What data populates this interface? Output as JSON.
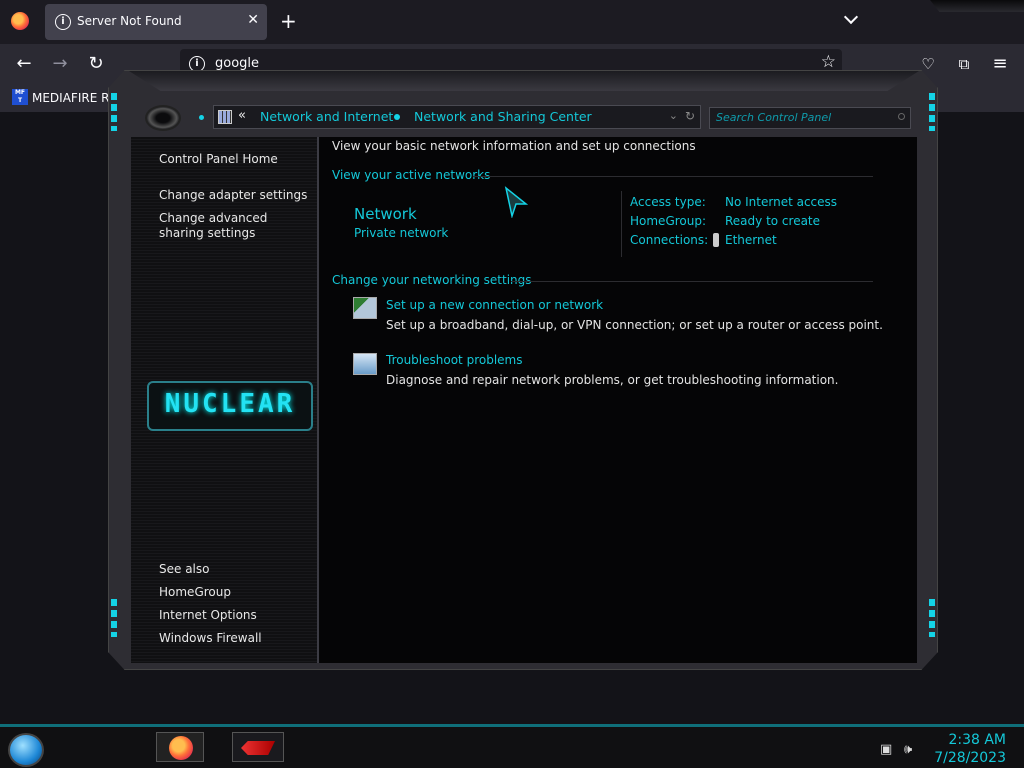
{
  "browser": {
    "tab_title": "Server Not Found",
    "new_tab_symbol": "+",
    "close_symbol": "✕",
    "url": "google",
    "bookmark_label": "MEDIAFIRE RO",
    "bookmark_icon_text": "MF T"
  },
  "control_panel": {
    "address": {
      "chevron": "«",
      "crumbs": [
        "Network and Internet",
        "Network and Sharing Center"
      ]
    },
    "search_placeholder": "Search Control Panel",
    "sidebar": {
      "home": "Control Panel Home",
      "items": [
        "Change adapter settings",
        "Change advanced sharing settings"
      ],
      "logo_text": "NUCLEAR",
      "see_also_heading": "See also",
      "see_also": [
        "HomeGroup",
        "Internet Options",
        "Windows Firewall"
      ]
    },
    "main": {
      "heading": "View your basic network information and set up connections",
      "active_networks_heading": "View your active networks",
      "network_name": "Network",
      "network_type": "Private network",
      "access_type_label": "Access type:",
      "access_type_value": "No Internet access",
      "homegroup_label": "HomeGroup:",
      "homegroup_value": "Ready to create",
      "connections_label": "Connections:",
      "connections_value": "Ethernet",
      "change_settings_heading": "Change your networking settings",
      "tasks": [
        {
          "title": "Set up a new connection or network",
          "desc": "Set up a broadband, dial-up, or VPN connection; or set up a router or access point."
        },
        {
          "title": "Troubleshoot problems",
          "desc": "Diagnose and repair network problems, or get troubleshooting information."
        }
      ]
    }
  },
  "taskbar": {
    "time": "2:38 AM",
    "date": "7/28/2023"
  },
  "colors": {
    "accent_teal": "#14c8d8",
    "browser_bg": "#2b2a33",
    "taskbar_bg": "#101012"
  }
}
